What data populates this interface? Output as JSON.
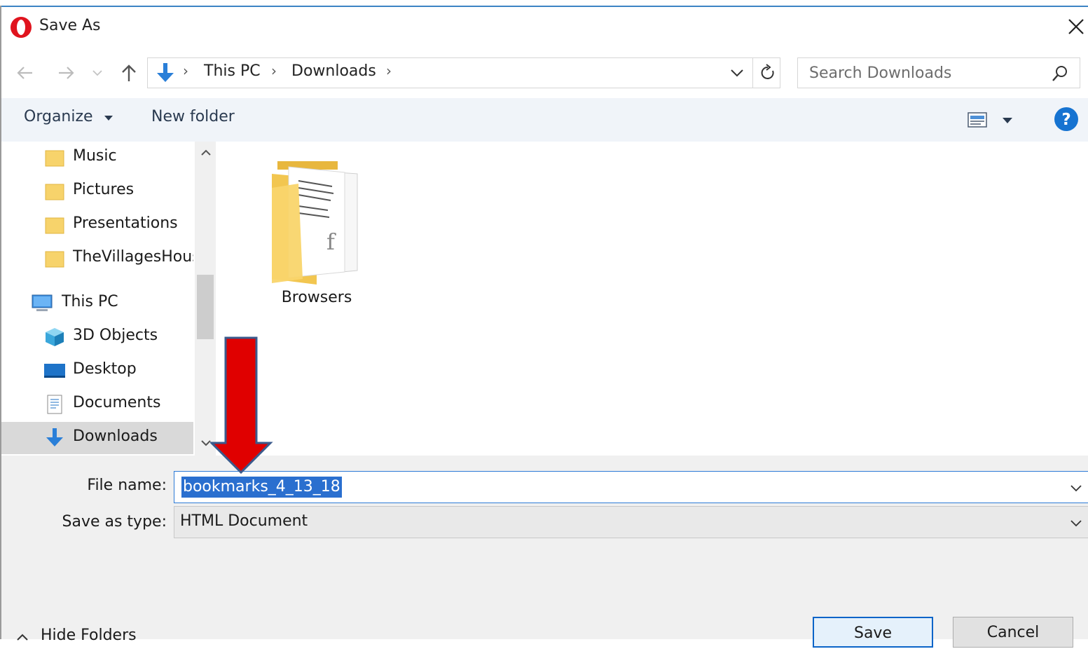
{
  "window": {
    "title": "Save As",
    "app_icon": "opera-icon"
  },
  "nav": {
    "back_icon": "back-arrow-icon",
    "forward_icon": "forward-arrow-icon",
    "recent_icon": "chevron-down-icon",
    "up_icon": "up-arrow-icon"
  },
  "address": {
    "crumbs": [
      "This PC",
      "Downloads"
    ],
    "separator": "›"
  },
  "search": {
    "placeholder": "Search Downloads"
  },
  "toolbar": {
    "organize_label": "Organize",
    "new_folder_label": "New folder"
  },
  "sidebar": {
    "items": [
      {
        "label": "Music",
        "icon": "folder-icon"
      },
      {
        "label": "Pictures",
        "icon": "folder-icon"
      },
      {
        "label": "Presentations",
        "icon": "folder-icon"
      },
      {
        "label": "TheVillagesHous",
        "icon": "folder-icon"
      },
      {
        "label": "This PC",
        "icon": "computer-icon"
      },
      {
        "label": "3D Objects",
        "icon": "cube-icon"
      },
      {
        "label": "Desktop",
        "icon": "desktop-icon"
      },
      {
        "label": "Documents",
        "icon": "documents-icon"
      },
      {
        "label": "Downloads",
        "icon": "download-icon",
        "selected": true
      }
    ]
  },
  "content": {
    "items": [
      {
        "label": "Browsers",
        "icon": "folder-with-documents-icon"
      }
    ]
  },
  "form": {
    "file_name_label": "File name:",
    "file_name_value": "bookmarks_4_13_18",
    "save_type_label": "Save as type:",
    "save_type_value": "HTML Document"
  },
  "footer": {
    "hide_folders_label": "Hide Folders",
    "save_label": "Save",
    "cancel_label": "Cancel"
  },
  "annotation": {
    "arrow_color": "#e00000",
    "arrow_outline": "#3a5a8c"
  },
  "colors": {
    "accent": "#2c7ad6",
    "help": "#1673d1",
    "toolbar_bg": "#f0f4f9"
  }
}
